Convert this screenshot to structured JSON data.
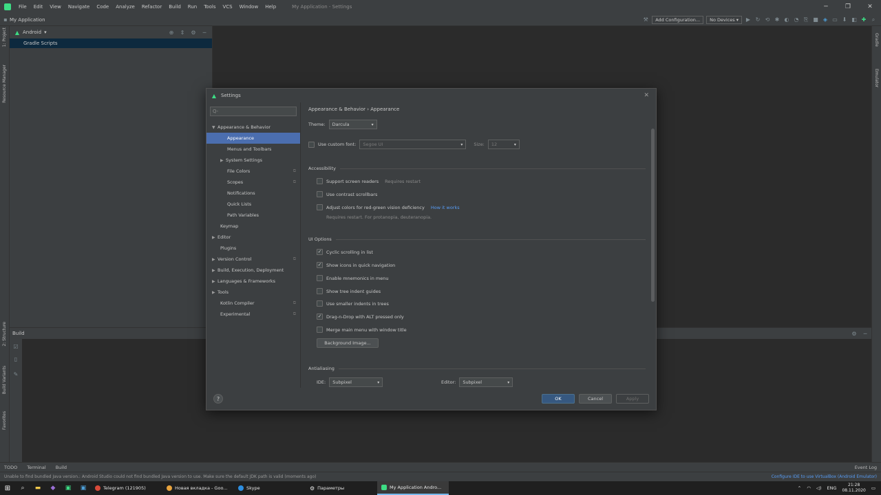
{
  "menubar": {
    "items": [
      "File",
      "Edit",
      "View",
      "Navigate",
      "Code",
      "Analyze",
      "Refactor",
      "Build",
      "Run",
      "Tools",
      "VCS",
      "Window",
      "Help"
    ],
    "window_title": "My Application - Settings"
  },
  "navbar": {
    "crumb": "My Application",
    "run_config": "Add Configuration...",
    "device": "No Devices"
  },
  "left_strip": {
    "top": "1: Project",
    "mid": "Resource Manager",
    "bottom1": "2: Structure",
    "bottom2": "Build Variants",
    "bottom3": "Favorites"
  },
  "right_strip": {
    "top": "Gradle",
    "mid": "Emulator"
  },
  "project_panel": {
    "title": "Android",
    "selected": "Gradle Scripts"
  },
  "build_panel": {
    "title": "Build"
  },
  "bottom_tabs": {
    "todo": "TODO",
    "terminal": "Terminal",
    "build": "Build",
    "event_log": "Event Log"
  },
  "statusbar": {
    "message": "Unable to find bundled Java version.: Android Studio could not find bundled Java version to use. Make sure the default JDK path is valid (moments ago)",
    "right": "Configure IDE to use VirtualBox (Android Emulator)"
  },
  "taskbar": {
    "apps": [
      "Telegram (121905)",
      "Новая вкладка - Goo...",
      "Skype",
      "Параметры",
      "My Application Andro..."
    ],
    "lang": "ENG",
    "time": "21:28",
    "date": "08.11.2020"
  },
  "dialog": {
    "title": "Settings",
    "search_placeholder": "Q-",
    "tree": [
      {
        "label": "Appearance & Behavior",
        "arrow": "▼",
        "level": 0
      },
      {
        "label": "Appearance",
        "level": 1,
        "selected": true
      },
      {
        "label": "Menus and Toolbars",
        "level": 1
      },
      {
        "label": "System Settings",
        "arrow": "▶",
        "level": 1
      },
      {
        "label": "File Colors",
        "level": 1,
        "copy": true
      },
      {
        "label": "Scopes",
        "level": 1,
        "copy": true
      },
      {
        "label": "Notifications",
        "level": 1
      },
      {
        "label": "Quick Lists",
        "level": 1
      },
      {
        "label": "Path Variables",
        "level": 1
      },
      {
        "label": "Keymap",
        "level": 0
      },
      {
        "label": "Editor",
        "arrow": "▶",
        "level": 0
      },
      {
        "label": "Plugins",
        "level": 0
      },
      {
        "label": "Version Control",
        "arrow": "▶",
        "level": 0,
        "copy": true
      },
      {
        "label": "Build, Execution, Deployment",
        "arrow": "▶",
        "level": 0
      },
      {
        "label": "Languages & Frameworks",
        "arrow": "▶",
        "level": 0
      },
      {
        "label": "Tools",
        "arrow": "▶",
        "level": 0
      },
      {
        "label": "Kotlin Compiler",
        "level": 0,
        "copy": true
      },
      {
        "label": "Experimental",
        "level": 0,
        "copy": true
      }
    ],
    "breadcrumb": "Appearance & Behavior  ›  Appearance",
    "theme_label": "Theme:",
    "theme_value": "Darcula",
    "custom_font_label": "Use custom font:",
    "custom_font_value": "Segoe UI",
    "size_label": "Size:",
    "size_value": "12",
    "accessibility": {
      "title": "Accessibility",
      "items": [
        {
          "label": "Support screen readers",
          "hint": "Requires restart",
          "checked": false
        },
        {
          "label": "Use contrast scrollbars",
          "checked": false
        },
        {
          "label": "Adjust colors for red-green vision deficiency",
          "link": "How it works",
          "hint2": "Requires restart. For protanopia, deuteranopia.",
          "checked": false
        }
      ]
    },
    "ui_options": {
      "title": "UI Options",
      "items": [
        {
          "label": "Cyclic scrolling in list",
          "checked": true
        },
        {
          "label": "Show icons in quick navigation",
          "checked": true
        },
        {
          "label": "Enable mnemonics in menu",
          "checked": false
        },
        {
          "label": "Show tree indent guides",
          "checked": false
        },
        {
          "label": "Use smaller indents in trees",
          "checked": false
        },
        {
          "label": "Drag-n-Drop with ALT pressed only",
          "checked": true
        },
        {
          "label": "Merge main menu with window title",
          "checked": false
        }
      ],
      "background_button": "Background Image..."
    },
    "antialiasing": {
      "title": "Antialiasing",
      "ide_label": "IDE:",
      "ide_value": "Subpixel",
      "editor_label": "Editor:",
      "editor_value": "Subpixel"
    },
    "footer": {
      "help": "?",
      "ok": "OK",
      "cancel": "Cancel",
      "apply": "Apply"
    }
  }
}
